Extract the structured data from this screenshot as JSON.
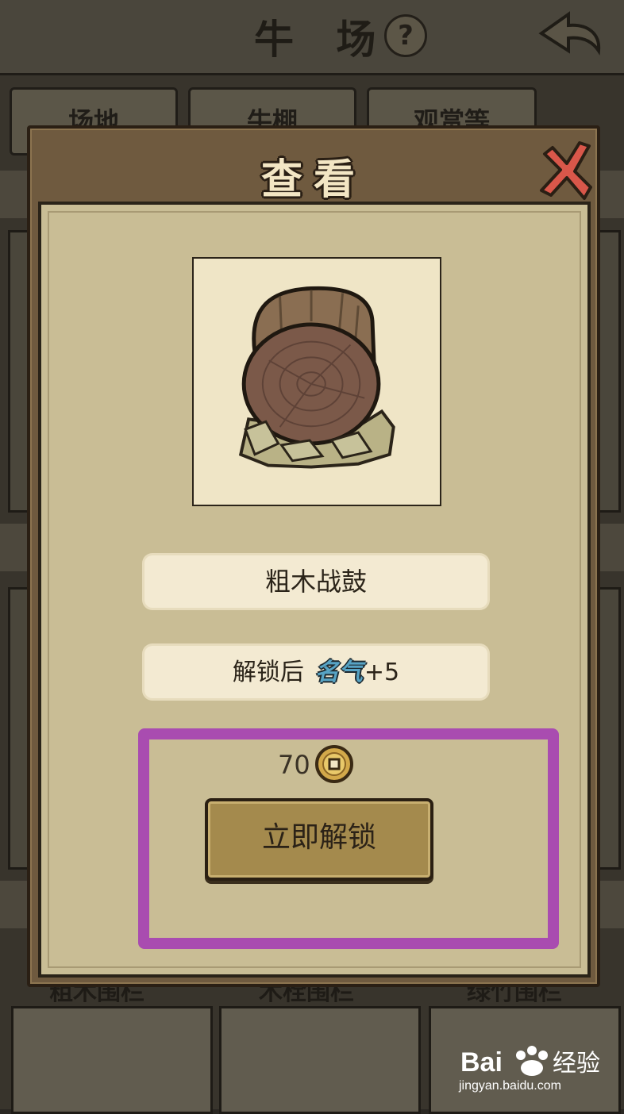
{
  "background": {
    "title": "牛 场",
    "help_glyph": "?",
    "tabs": [
      "场地",
      "牛棚",
      "观赏等"
    ],
    "bottom_labels": [
      "粗木围栏",
      "木栓围栏",
      "绿竹围栏"
    ]
  },
  "dialog": {
    "title": "查看",
    "item_name": "粗木战鼓",
    "bonus_prefix": "解锁后",
    "bonus_stat": "名气",
    "bonus_value": "+5",
    "price": "70",
    "unlock_label": "立即解锁"
  },
  "watermark": {
    "logo": "Bai 经验",
    "url": "jingyan.baidu.com"
  },
  "colors": {
    "highlight": "#a94cb0",
    "fame": "#57a3c4"
  }
}
